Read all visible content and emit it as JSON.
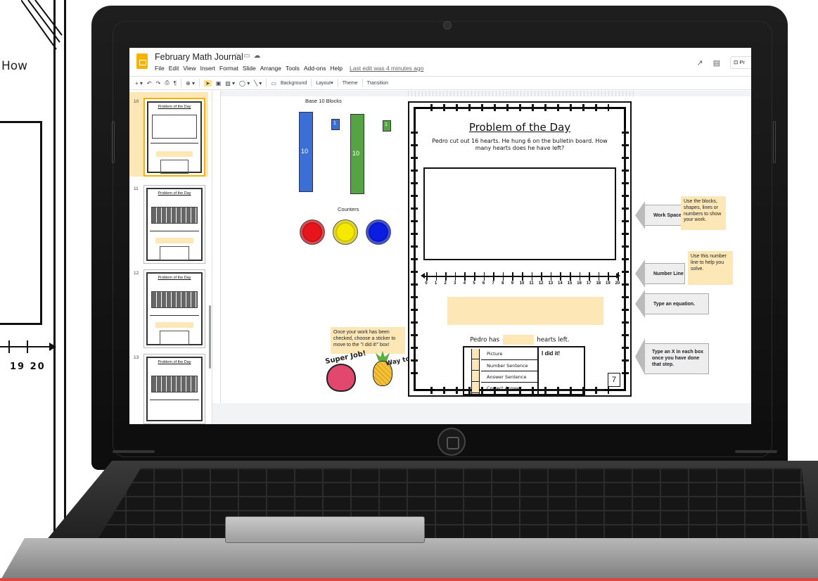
{
  "background_sheet": {
    "text_fragment": "How",
    "numbers": [
      "19",
      "20"
    ]
  },
  "app": {
    "doc_title": "February Math Journal",
    "last_edit": "Last edit was 4 minutes ago",
    "menu": [
      "File",
      "Edit",
      "View",
      "Insert",
      "Format",
      "Slide",
      "Arrange",
      "Tools",
      "Add-ons",
      "Help"
    ],
    "present_label": "Pr",
    "accent_color": "#f4b400"
  },
  "toolbar": {
    "background": "Background",
    "layout": "Layout▾",
    "theme": "Theme",
    "transition": "Transition"
  },
  "filmstrip": {
    "slides": [
      {
        "number": "10",
        "title": "Problem of the Day",
        "active": true
      },
      {
        "number": "11",
        "title": "Problem of the Day",
        "active": false
      },
      {
        "number": "12",
        "title": "Problem of the Day",
        "active": false
      },
      {
        "number": "13",
        "title": "Problem of the Day",
        "active": false
      }
    ]
  },
  "manipulatives": {
    "blocks_label": "Base 10 Blocks",
    "ten_label": "10",
    "one_label": "1",
    "counters_label": "Counters",
    "colors": {
      "blue": "#3c6fd6",
      "green": "#56a345",
      "red": "#e8141c",
      "yellow": "#f7e800",
      "counter_blue": "#0a1de0"
    },
    "sticker_note": "Once your work has been checked, choose a sticker to move to the \"I did it!\" box!",
    "sticker_text_1": "Super Job!",
    "sticker_text_2": "Way to go!"
  },
  "worksheet": {
    "title": "Problem of the Day",
    "question": "Pedro cut out 16 hearts. He hung 6 on the bulletin board. How many hearts does he have left?",
    "number_line": [
      "0",
      "1",
      "2",
      "3",
      "4",
      "5",
      "6",
      "7",
      "8",
      "9",
      "10",
      "11",
      "12",
      "13",
      "14",
      "15",
      "16",
      "17",
      "18",
      "19",
      "20"
    ],
    "answer_prefix": "Pedro has",
    "answer_suffix": "hearts left.",
    "checklist": [
      "Picture",
      "Number Sentence",
      "Answer Sentence",
      "Correct Answer"
    ],
    "did_it": "I did it!",
    "page_number": "7"
  },
  "callouts": {
    "work_space": "Work Space",
    "work_space_note": "Use the blocks, shapes, lines  or numbers to show your work.",
    "number_line": "Number Line",
    "number_line_note": "Use this number line to help you solve.",
    "equation": "Type an equation.",
    "checkbox": "Type an X in each box once you have done that step."
  }
}
